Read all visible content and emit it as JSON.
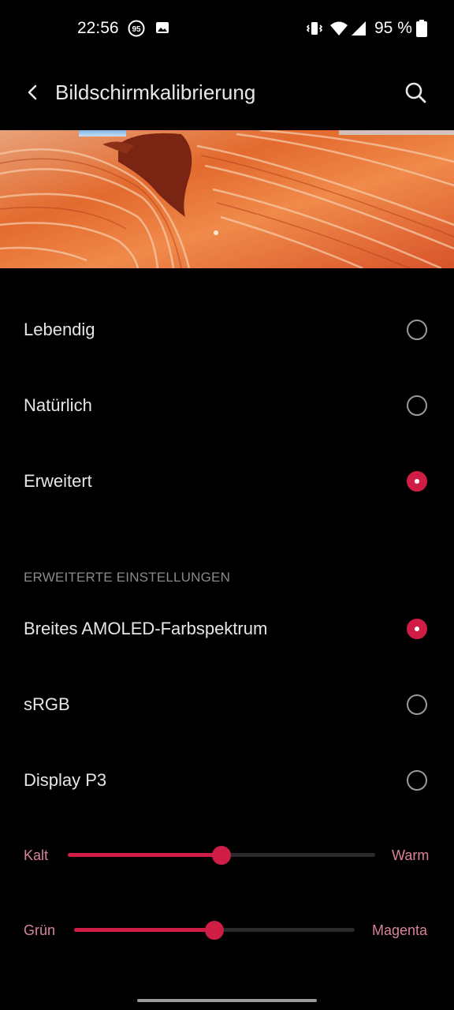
{
  "status_bar": {
    "time": "22:56",
    "notification_badge": "95",
    "battery": "95 %",
    "icons": [
      "badge-95-icon",
      "image-icon",
      "vibrate-icon",
      "wifi-icon",
      "signal-icon",
      "battery-icon"
    ]
  },
  "app_bar": {
    "title": "Bildschirmkalibrierung",
    "back_icon": "back-arrow-icon",
    "search_icon": "search-icon"
  },
  "modes": [
    {
      "label": "Lebendig",
      "checked": false
    },
    {
      "label": "Natürlich",
      "checked": false
    },
    {
      "label": "Erweitert",
      "checked": true
    }
  ],
  "advanced": {
    "header": "ERWEITERTE EINSTELLUNGEN",
    "options": [
      {
        "label": "Breites AMOLED-Farbspektrum",
        "checked": true
      },
      {
        "label": "sRGB",
        "checked": false
      },
      {
        "label": "Display P3",
        "checked": false
      }
    ]
  },
  "sliders": {
    "temperature": {
      "min_label": "Kalt",
      "max_label": "Warm",
      "value": 0.5
    },
    "tint": {
      "min_label": "Grün",
      "max_label": "Magenta",
      "value": 0.5
    }
  },
  "colors": {
    "accent": "#cf1d45",
    "background": "#000000",
    "slider_label": "#d9829a"
  }
}
